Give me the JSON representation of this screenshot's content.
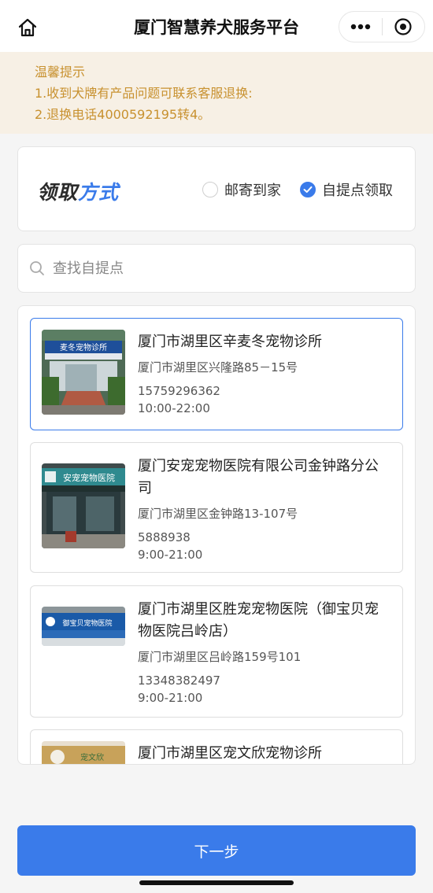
{
  "header": {
    "title": "厦门智慧养犬服务平台",
    "home_icon": "home-icon",
    "more_icon": "more-dots-icon",
    "close_icon": "target-close-icon"
  },
  "notice": {
    "title": "温馨提示",
    "line1": "1.收到犬牌有产品问题可联系客服退换:",
    "line2": "2.退换电话4000592195转4。"
  },
  "method": {
    "title_part1": "领取",
    "title_part2": "方式",
    "option_mail": "邮寄到家",
    "option_pickup": "自提点领取",
    "selected": "自提点领取"
  },
  "search": {
    "placeholder": "查找自提点",
    "value": ""
  },
  "stores": [
    {
      "name": "厦门市湖里区辛麦冬宠物诊所",
      "address": "厦门市湖里区兴隆路85－15号",
      "phone": "15759296362",
      "hours": "10:00-22:00",
      "sign_text": "麦冬宠物诊所",
      "selected": true
    },
    {
      "name": "厦门安宠宠物医院有限公司金钟路分公司",
      "address": "厦门市湖里区金钟路13-107号",
      "phone": "5888938",
      "hours": "9:00-21:00",
      "sign_text": "安宠宠物医院",
      "selected": false
    },
    {
      "name": "厦门市湖里区胜宠宠物医院（御宝贝宠物医院吕岭店）",
      "address": "厦门市湖里区吕岭路159号101",
      "phone": "13348382497",
      "hours": "9:00-21:00",
      "sign_text": "御宝贝宠物医院",
      "selected": false
    },
    {
      "name": "厦门市湖里区宠文欣宠物诊所",
      "address": "",
      "phone": "",
      "hours": "",
      "sign_text": "宠文欣",
      "selected": false
    }
  ],
  "footer": {
    "next_label": "下一步"
  },
  "colors": {
    "accent": "#3a7bea",
    "notice_bg": "#f7f0e5",
    "notice_text": "#c8912f"
  }
}
